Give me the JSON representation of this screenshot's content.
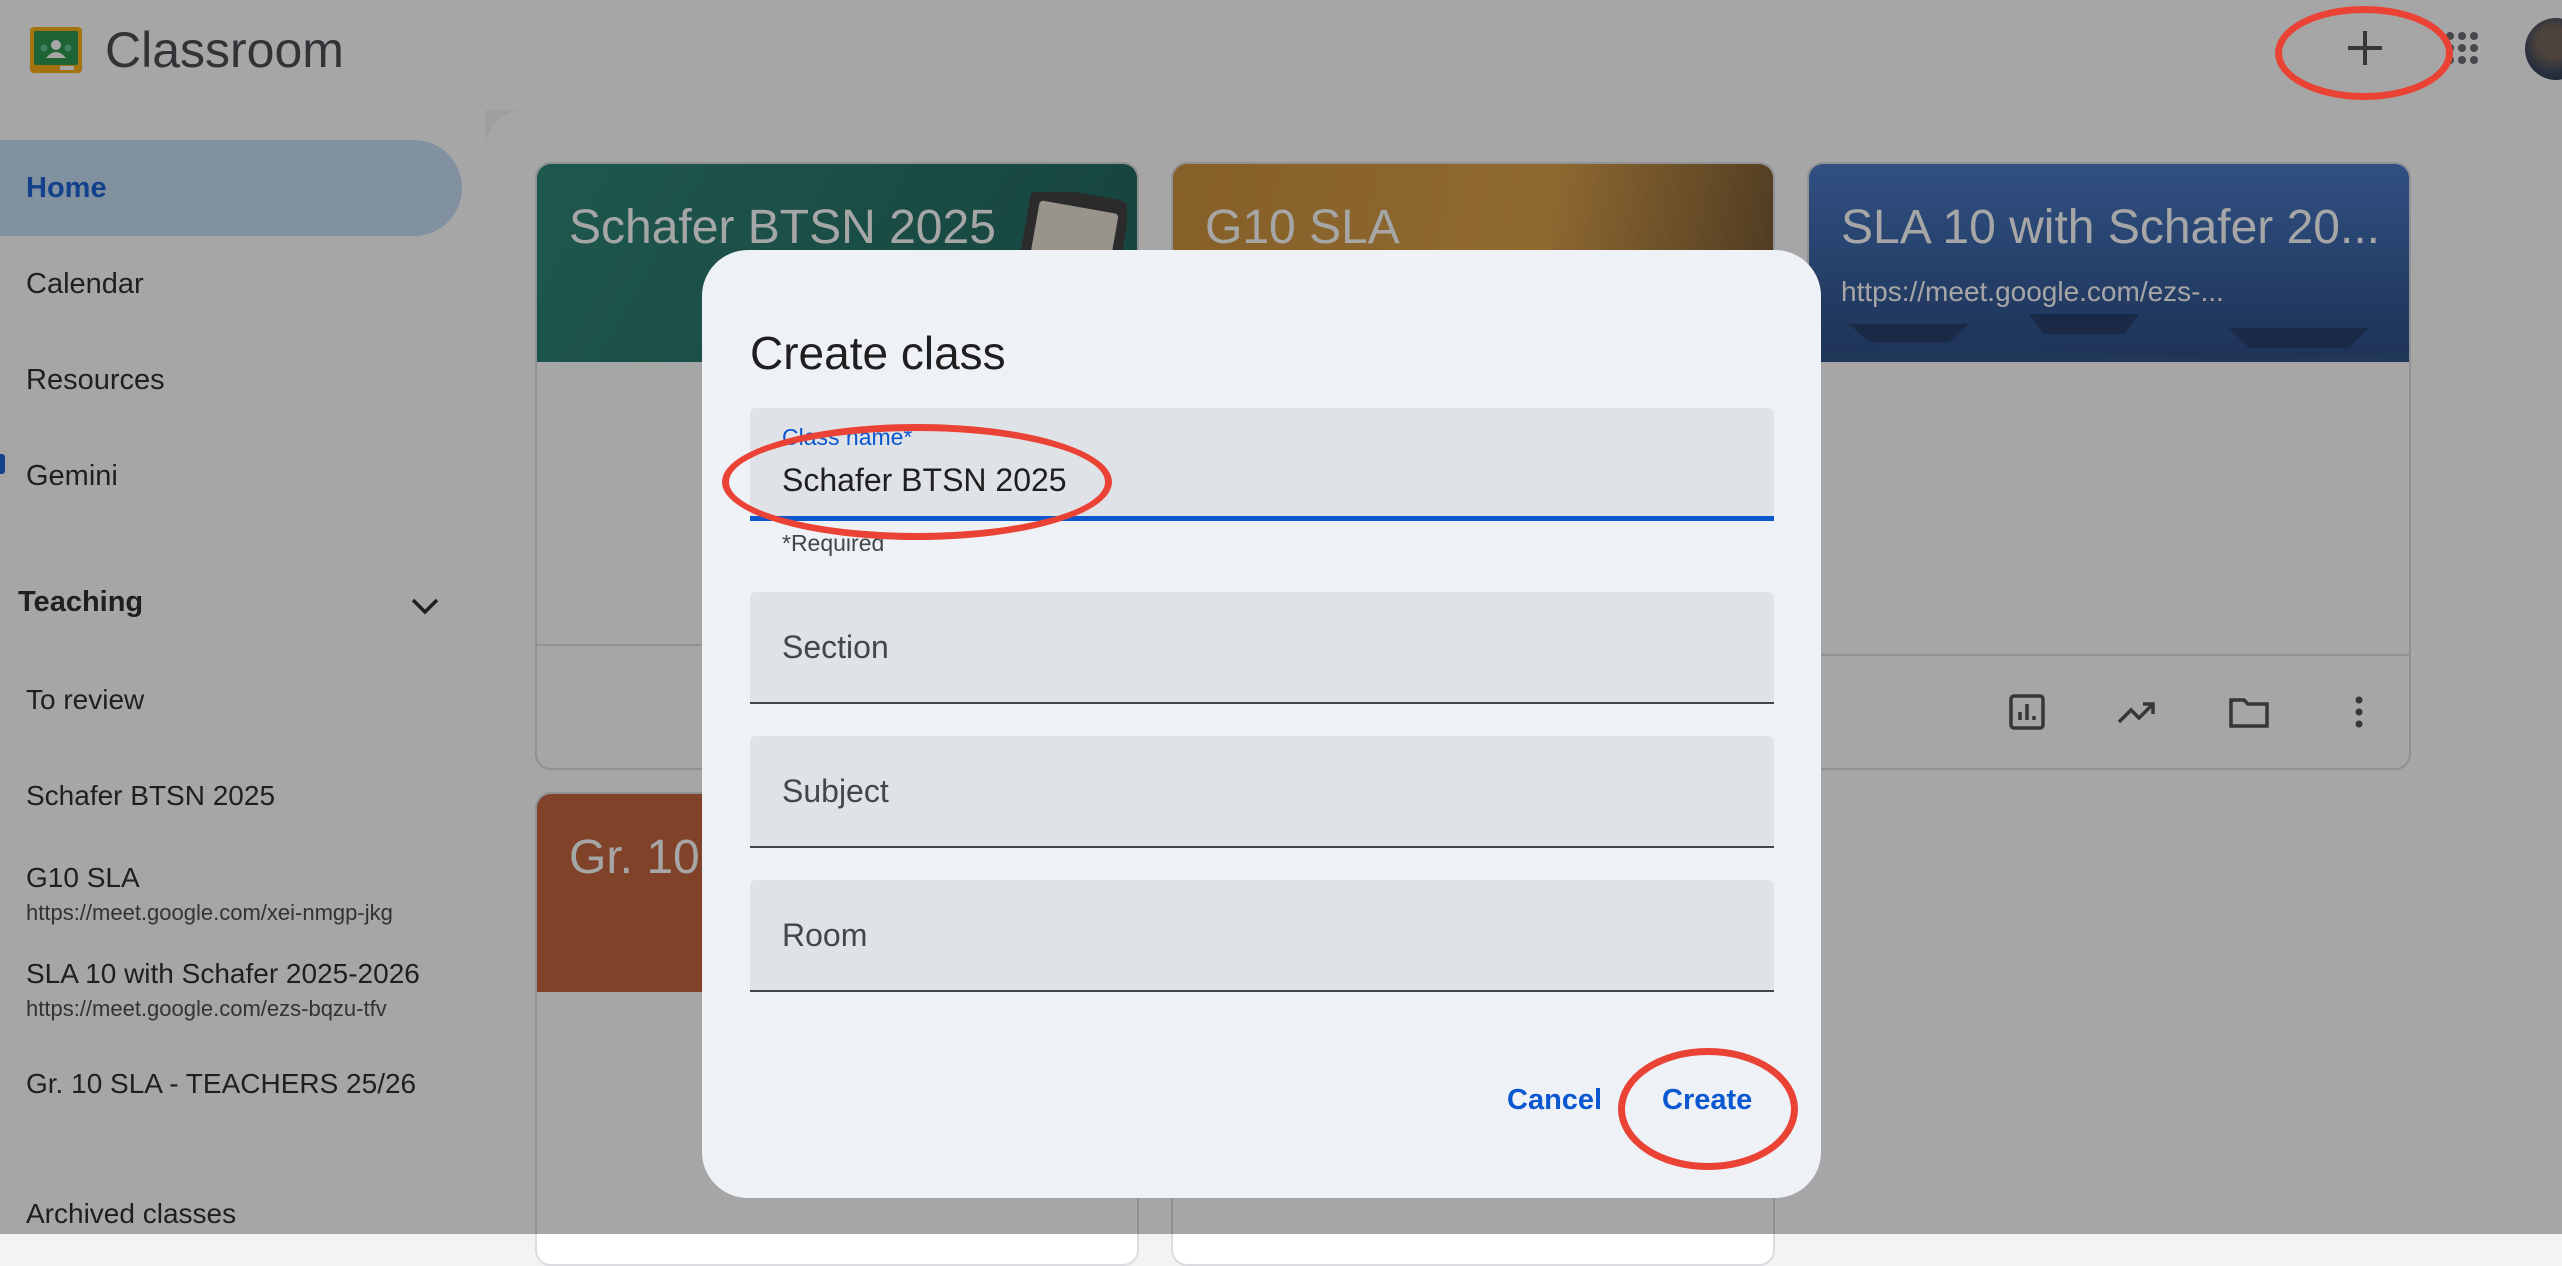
{
  "app": {
    "title": "Classroom",
    "logo_icon": "classroom-logo-icon"
  },
  "header": {
    "create_icon": "plus-icon",
    "apps_icon": "apps-grid-icon"
  },
  "sidebar": {
    "nav": [
      {
        "label": "Home",
        "active": true
      },
      {
        "label": "Calendar"
      },
      {
        "label": "Resources"
      },
      {
        "label": "Gemini"
      }
    ],
    "teaching_label": "Teaching",
    "to_review": "To review",
    "classes": [
      {
        "name": "Schafer BTSN 2025",
        "sub": ""
      },
      {
        "name": "G10 SLA",
        "sub": "https://meet.google.com/xei-nmgp-jkg"
      },
      {
        "name": "SLA 10 with Schafer 2025-2026",
        "sub": "https://meet.google.com/ezs-bqzu-tfv"
      },
      {
        "name": "Gr. 10 SLA - TEACHERS 25/26",
        "sub": ""
      }
    ],
    "archived": "Archived classes"
  },
  "cards": [
    {
      "title": "Schafer BTSN 2025",
      "sub": "",
      "color": "#1e7d6b"
    },
    {
      "title": "G10 SLA",
      "sub": "",
      "color": "#c98a2c"
    },
    {
      "title": "SLA 10 with Schafer 20...",
      "sub": "https://meet.google.com/ezs-...",
      "color": "#2c5aa0"
    },
    {
      "title": "Gr. 10",
      "sub": "",
      "color": "#c05a2e"
    }
  ],
  "dialog": {
    "title": "Create class",
    "class_name_label": "Class name*",
    "class_name_value": "Schafer BTSN 2025",
    "required_hint": "*Required",
    "section_placeholder": "Section",
    "subject_placeholder": "Subject",
    "room_placeholder": "Room",
    "cancel_label": "Cancel",
    "create_label": "Create"
  },
  "colors": {
    "accent": "#0b57d0",
    "annotation": "#ea4335"
  }
}
